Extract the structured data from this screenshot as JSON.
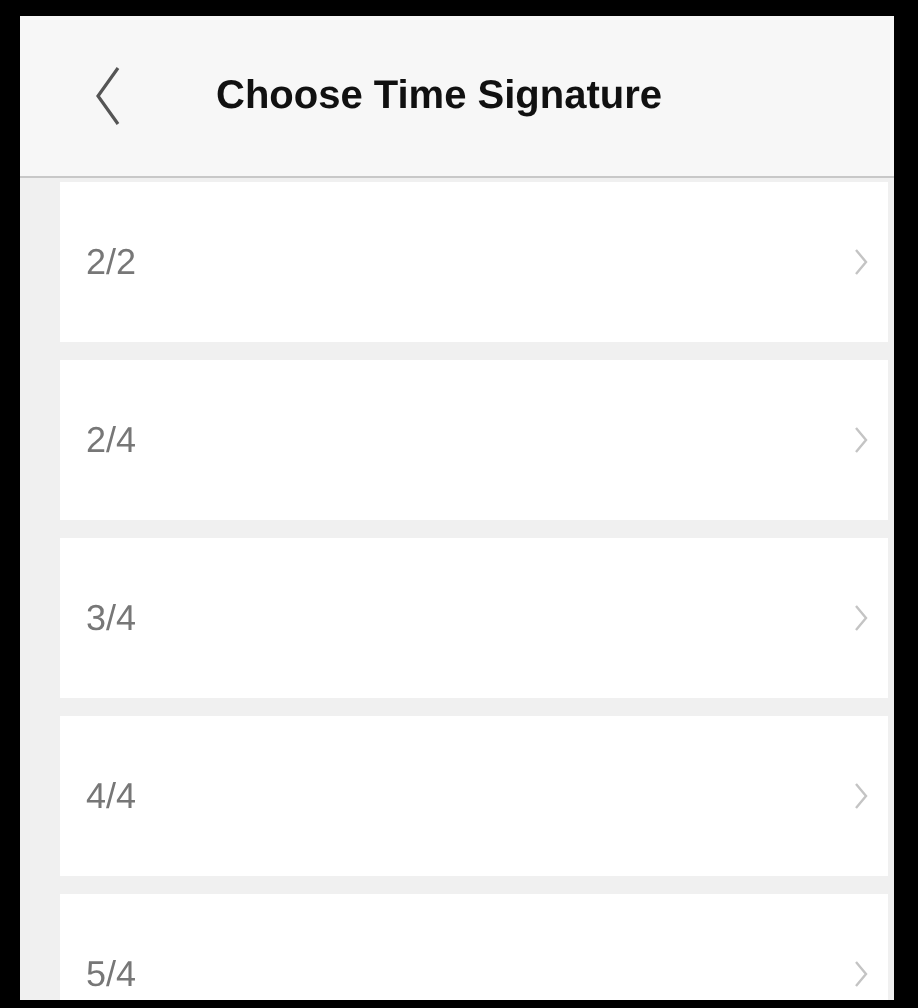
{
  "header": {
    "title": "Choose Time Signature"
  },
  "options": [
    {
      "label": "2/2"
    },
    {
      "label": "2/4"
    },
    {
      "label": "3/4"
    },
    {
      "label": "4/4"
    },
    {
      "label": "5/4"
    }
  ]
}
